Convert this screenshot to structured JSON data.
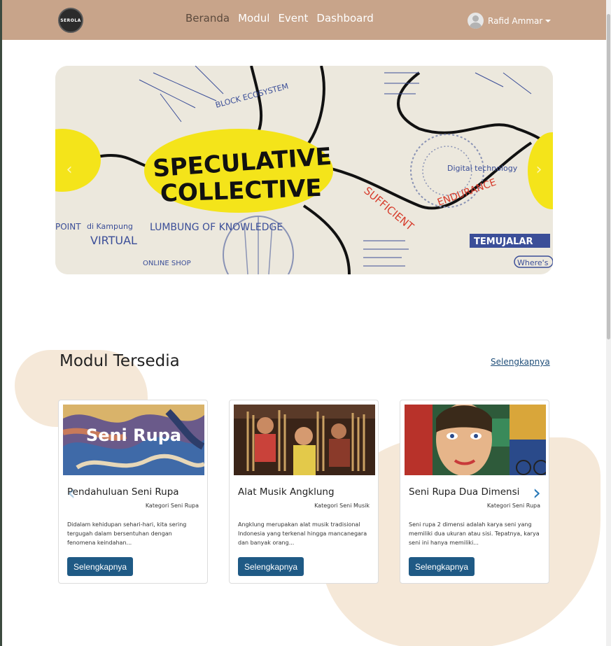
{
  "navbar": {
    "logo_text": "SEROLA",
    "links": [
      {
        "label": "Beranda",
        "active": true
      },
      {
        "label": "Modul",
        "active": false
      },
      {
        "label": "Event",
        "active": false
      },
      {
        "label": "Dashboard",
        "active": false
      }
    ],
    "user_name": "Rafid Ammar"
  },
  "hero": {
    "image_text": {
      "main_line1": "SPECULATIVE",
      "main_line2": "COLLECTIVE",
      "words": [
        "SUFFICIENT",
        "ENDURANCE",
        "LUMBUNG OF KNOWLEDGE",
        "VIRTUAL",
        "TEMUJALAR",
        "Where's",
        "Digital technology",
        "POINT",
        "di Kampung",
        "ONLINE SHOP",
        "BLOCK ECOSYSTEM"
      ]
    },
    "prev_icon": "chevron-left-icon",
    "next_icon": "chevron-right-icon"
  },
  "modules": {
    "title": "Modul Tersedia",
    "see_more": "Selengkapnya",
    "cards": [
      {
        "title": "Pendahuluan Seni Rupa",
        "category": "Kategori Seni Rupa",
        "description": "Didalam kehidupan sehari-hari, kita sering tergugah dalam bersentuhan dengan fenomena keindahan...",
        "button": "Selengkapnya",
        "image_label": "Seni Rupa"
      },
      {
        "title": "Alat Musik Angklung",
        "category": "Kategori Seni Musik",
        "description": "Angklung merupakan alat musik tradisional Indonesia yang terkenal hingga mancanegara dan banyak orang...",
        "button": "Selengkapnya",
        "image_label": ""
      },
      {
        "title": "Seni Rupa Dua Dimensi",
        "category": "Kategori Seni Rupa",
        "description": "Seni rupa 2 dimensi adalah karya seni yang memiliki dua ukuran atau sisi. Tepatnya, karya seni ini hanya memiliki...",
        "button": "Selengkapnya",
        "image_label": ""
      }
    ]
  },
  "colors": {
    "navbar_bg": "#c8a48a",
    "button_bg": "#1f5a85",
    "blob": "#f5e8d8"
  }
}
